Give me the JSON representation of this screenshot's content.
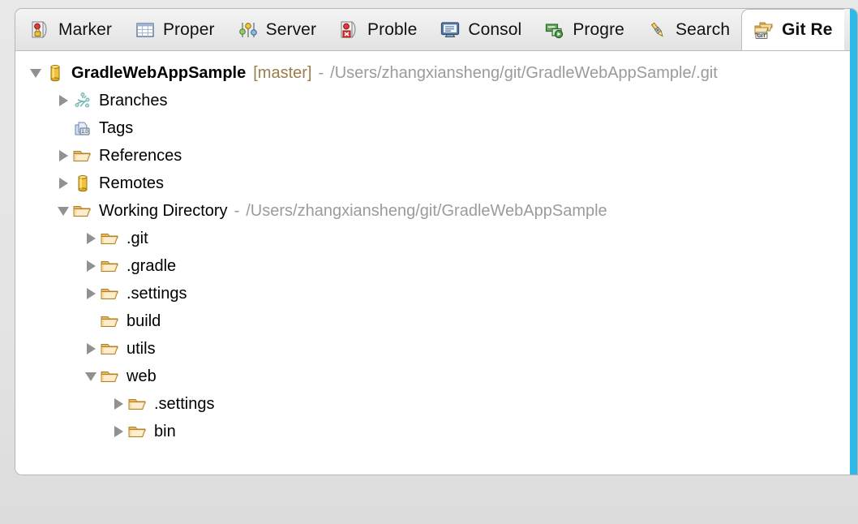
{
  "window": {
    "accent_scrollbar_color": "#2fb8ea",
    "panel_background": "#ffffff",
    "chrome_background": "#e4e4e4"
  },
  "tabs": [
    {
      "label": "Marker",
      "icon": "markers-icon",
      "active": false
    },
    {
      "label": "Proper",
      "icon": "properties-icon",
      "active": false
    },
    {
      "label": "Server",
      "icon": "servers-icon",
      "active": false
    },
    {
      "label": "Proble",
      "icon": "problems-icon",
      "active": false
    },
    {
      "label": "Consol",
      "icon": "console-icon",
      "active": false
    },
    {
      "label": "Progre",
      "icon": "progress-icon",
      "active": false
    },
    {
      "label": "Search",
      "icon": "search-pen-icon",
      "active": false
    },
    {
      "label": "Git Re",
      "icon": "git-repositories-icon",
      "active": true
    }
  ],
  "tree": [
    {
      "label": "GradleWebAppSample",
      "bold": true,
      "branch": "[master]",
      "dash": "-",
      "path": "/Users/zhangxiansheng/git/GradleWebAppSample/.git",
      "icon": "repository-icon",
      "state": "expanded",
      "depth": 0,
      "name": "tree-item-gradlewebappsample"
    },
    {
      "label": "Branches",
      "icon": "branches-icon",
      "state": "collapsed",
      "depth": 1,
      "name": "tree-item-branches"
    },
    {
      "label": "Tags",
      "icon": "tags-icon",
      "state": "none",
      "depth": 1,
      "name": "tree-item-tags"
    },
    {
      "label": "References",
      "icon": "folder-icon",
      "state": "collapsed",
      "depth": 1,
      "name": "tree-item-references"
    },
    {
      "label": "Remotes",
      "icon": "repository-icon",
      "state": "collapsed",
      "depth": 1,
      "name": "tree-item-remotes"
    },
    {
      "label": "Working Directory",
      "icon": "folder-icon",
      "state": "expanded",
      "depth": 1,
      "dash": "-",
      "path": "/Users/zhangxiansheng/git/GradleWebAppSample",
      "name": "tree-item-working-directory"
    },
    {
      "label": ".git",
      "icon": "folder-icon",
      "state": "collapsed",
      "depth": 2,
      "name": "tree-item-dot-git"
    },
    {
      "label": ".gradle",
      "icon": "folder-icon",
      "state": "collapsed",
      "depth": 2,
      "name": "tree-item-dot-gradle"
    },
    {
      "label": ".settings",
      "icon": "folder-icon",
      "state": "collapsed",
      "depth": 2,
      "name": "tree-item-dot-settings"
    },
    {
      "label": "build",
      "icon": "folder-icon",
      "state": "none",
      "depth": 2,
      "name": "tree-item-build"
    },
    {
      "label": "utils",
      "icon": "folder-icon",
      "state": "collapsed",
      "depth": 2,
      "name": "tree-item-utils"
    },
    {
      "label": "web",
      "icon": "folder-icon",
      "state": "expanded",
      "depth": 2,
      "name": "tree-item-web"
    },
    {
      "label": ".settings",
      "icon": "folder-icon",
      "state": "collapsed",
      "depth": 3,
      "name": "tree-item-web-settings"
    },
    {
      "label": "bin",
      "icon": "folder-icon",
      "state": "collapsed",
      "depth": 3,
      "name": "tree-item-web-bin"
    }
  ]
}
